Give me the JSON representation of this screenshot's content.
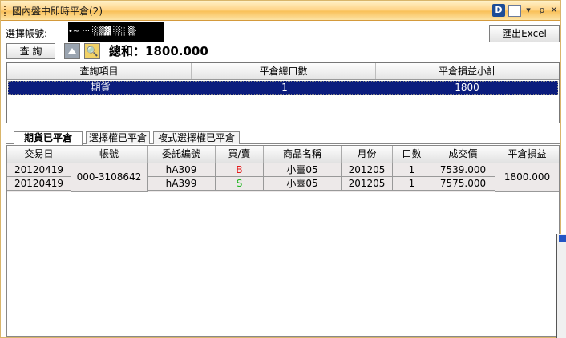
{
  "window": {
    "title": "國內盤中即時平倉(2)"
  },
  "titlebar_icons": [
    "d-app-icon",
    "document-icon",
    "dropdown-icon",
    "pin-icon",
    "close-icon"
  ],
  "titlebar_glyphs": {
    "d": "D",
    "dropdown": "▾",
    "pin": "ᵽ",
    "close": "✕"
  },
  "account": {
    "label": "選擇帳號:",
    "value": "•~ ··· ░▒▓ ░░ ▒·"
  },
  "toolbar": {
    "query_label": "查 詢",
    "search_glyph": "🔍",
    "export_label": "匯出Excel",
    "sum_label": "總和：",
    "sum_value": "1800.000"
  },
  "summary_table": {
    "headers": [
      "查詢項目",
      "平倉總口數",
      "平倉損益小計"
    ],
    "rows": [
      {
        "item": "期貨",
        "lots": "1",
        "pnl": "1800"
      }
    ]
  },
  "tabs": [
    "期貨已平倉",
    "選擇權已平倉",
    "複式選擇權已平倉"
  ],
  "detail_table": {
    "headers": [
      "交易日",
      "帳號",
      "委託編號",
      "買/賣",
      "商品名稱",
      "月份",
      "口數",
      "成交價",
      "平倉損益"
    ],
    "account": "000-3108642",
    "pnl": "1800.000",
    "rows": [
      {
        "date": "20120419",
        "order": "hA309",
        "side": "B",
        "product": "小臺05",
        "month": "201205",
        "lots": "1",
        "price": "7539.000"
      },
      {
        "date": "20120419",
        "order": "hA399",
        "side": "S",
        "product": "小臺05",
        "month": "201205",
        "lots": "1",
        "price": "7575.000"
      }
    ]
  },
  "colors": {
    "buy": "#e31b1b",
    "sell": "#1fb51f",
    "selected_row": "#0b1c7d",
    "titlebar": "#f9c15a"
  }
}
